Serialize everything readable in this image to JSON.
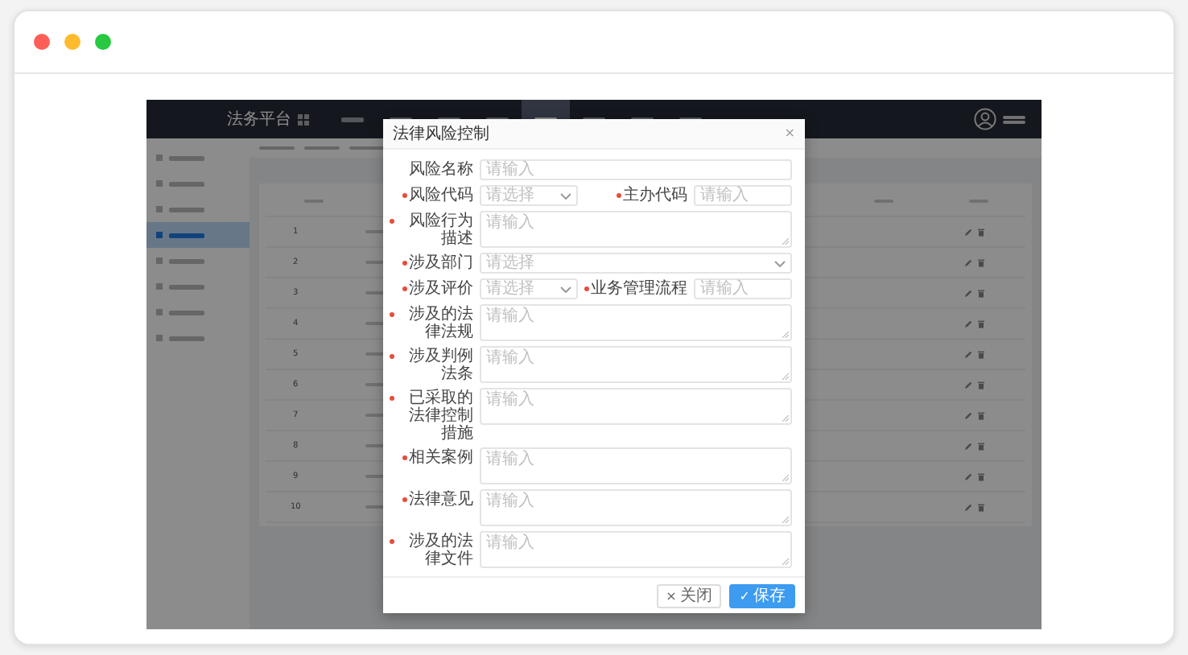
{
  "window": {
    "dots": [
      {
        "color": "#fd5f57"
      },
      {
        "color": "#febb2e"
      },
      {
        "color": "#28c840"
      }
    ]
  },
  "app": {
    "title": "法务平台",
    "nav_items": [
      {
        "selected": false
      },
      {
        "selected": false
      },
      {
        "selected": false
      },
      {
        "selected": false
      },
      {
        "selected": true
      },
      {
        "selected": false
      },
      {
        "selected": false
      },
      {
        "selected": false
      }
    ],
    "sidebar": {
      "items": [
        {
          "selected": false
        },
        {
          "selected": false
        },
        {
          "selected": false
        },
        {
          "selected": true
        },
        {
          "selected": false
        },
        {
          "selected": false
        },
        {
          "selected": false
        },
        {
          "selected": false
        }
      ]
    },
    "table": {
      "rows": [
        {
          "index": "1"
        },
        {
          "index": "2"
        },
        {
          "index": "3"
        },
        {
          "index": "4"
        },
        {
          "index": "5"
        },
        {
          "index": "6"
        },
        {
          "index": "7"
        },
        {
          "index": "8"
        },
        {
          "index": "9"
        },
        {
          "index": "10"
        }
      ]
    }
  },
  "dialog": {
    "title": "法律风险控制",
    "close": "×",
    "fields": [
      {
        "kind": "input",
        "label": "风险名称",
        "placeholder": "请输入",
        "required": false
      },
      {
        "kind": "pair",
        "items": [
          {
            "kind": "select",
            "label": "风险代码",
            "placeholder": "请选择",
            "required": true
          },
          {
            "kind": "input",
            "label": "主办代码",
            "placeholder": "请输入",
            "required": true
          }
        ]
      },
      {
        "kind": "textarea",
        "label": "风险行为描述",
        "placeholder": "请输入",
        "required": true
      },
      {
        "kind": "select",
        "label": "涉及部门",
        "placeholder": "请选择",
        "required": true
      },
      {
        "kind": "pair",
        "items": [
          {
            "kind": "select",
            "label": "涉及评价",
            "placeholder": "请选择",
            "required": true
          },
          {
            "kind": "input",
            "label": "业务管理流程",
            "placeholder": "请输入",
            "required": true
          }
        ]
      },
      {
        "kind": "textarea",
        "label": "涉及的法律法规",
        "placeholder": "请输入",
        "required": true
      },
      {
        "kind": "textarea",
        "label": "涉及判例法条",
        "placeholder": "请输入",
        "required": true
      },
      {
        "kind": "textarea",
        "label": "已采取的法律控制措施",
        "placeholder": "请输入",
        "required": true
      },
      {
        "kind": "textarea",
        "label": "相关案例",
        "placeholder": "请输入",
        "required": true
      },
      {
        "kind": "textarea",
        "label": "法律意见",
        "placeholder": "请输入",
        "required": true
      },
      {
        "kind": "textarea",
        "label": "涉及的法律文件",
        "placeholder": "请输入",
        "required": true
      }
    ],
    "buttons": [
      {
        "kind": "default",
        "icon": "×",
        "label": "关闭"
      },
      {
        "kind": "primary",
        "icon": "✓",
        "label": "保存"
      }
    ]
  }
}
